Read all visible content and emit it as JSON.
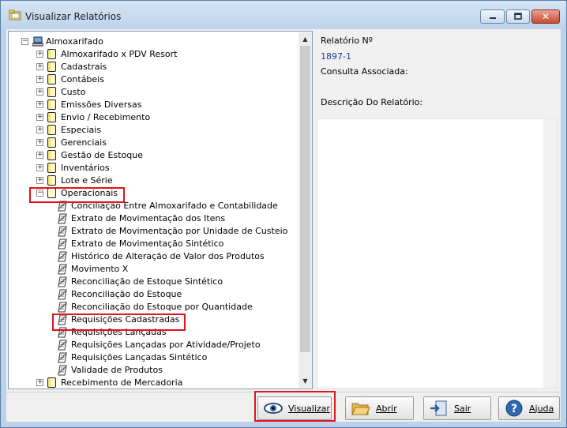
{
  "window": {
    "title": "Visualizar Relatórios",
    "close_glyph": "✕"
  },
  "tree": {
    "root": "Almoxarifado",
    "folders_before": [
      "Almoxarifado x PDV Resort",
      "Cadastrais",
      "Contábeis",
      "Custo",
      "Emissões Diversas",
      "Envio / Recebimento",
      "Especiais",
      "Gerenciais",
      "Gestão de Estoque",
      "Inventários",
      "Lote e Série"
    ],
    "expanded_folder": "Operacionais",
    "reports": [
      "Conciliação Entre Almoxarifado e Contabilidade",
      "Extrato de Movimentação dos Itens",
      "Extrato de Movimentação por Unidade de Custeio",
      "Extrato de Movimentação Sintético",
      "Histórico de Alteração de Valor dos Produtos",
      "Movimento X",
      "Reconciliação de Estoque Sintético",
      "Reconciliação do Estoque",
      "Reconciliação do Estoque por Quantidade",
      "Requisições Cadastradas",
      "Requisições Lançadas",
      "Requisições Lançadas por Atividade/Projeto",
      "Requisições Lançadas Sintético",
      "Validade de Produtos"
    ],
    "selected_report_index": 9,
    "folders_after": [
      "Recebimento de Mercadoria"
    ]
  },
  "details": {
    "report_no_label": "Relatório Nº",
    "report_no_value": "1897-1",
    "query_label": "Consulta Associada:",
    "description_label": "Descrição Do Relatório:"
  },
  "buttons": {
    "view": "Visualizar",
    "open": "Abrir",
    "exit": "Sair",
    "help": "Ajuda"
  },
  "colors": {
    "highlight": "#e0141c",
    "link_value": "#1d3f8a"
  }
}
